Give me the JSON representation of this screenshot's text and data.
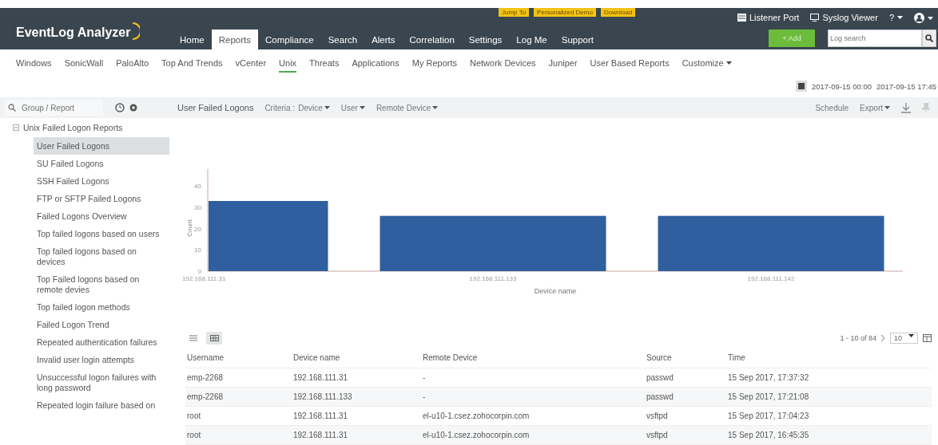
{
  "header": {
    "logo": "EventLog Analyzer",
    "promo_links": [
      "Jump To",
      "Personalized Demo",
      "Download"
    ],
    "tools": [
      {
        "kind": "listener",
        "label": "Listener Port"
      },
      {
        "kind": "syslog",
        "label": "Syslog Viewer"
      },
      {
        "kind": "help",
        "label": "?"
      },
      {
        "kind": "user"
      }
    ],
    "nav": [
      {
        "label": "Home",
        "selected": false
      },
      {
        "label": "Reports",
        "selected": true
      },
      {
        "label": "Compliance",
        "selected": false
      },
      {
        "label": "Search",
        "selected": false
      },
      {
        "label": "Alerts",
        "selected": false
      },
      {
        "label": "Correlation",
        "selected": false
      },
      {
        "label": "Settings",
        "selected": false
      },
      {
        "label": "Log Me",
        "selected": false
      },
      {
        "label": "Support",
        "selected": false
      }
    ],
    "add_button": "+ Add",
    "search": {
      "placeholder": "Log search"
    }
  },
  "subnav": {
    "items": [
      {
        "label": "Windows",
        "selected": false
      },
      {
        "label": "SonicWall",
        "selected": false
      },
      {
        "label": "PaloAlto",
        "selected": false
      },
      {
        "label": "Top And Trends",
        "selected": false
      },
      {
        "label": "vCenter",
        "selected": false
      },
      {
        "label": "Unix",
        "selected": true
      },
      {
        "label": "Threats",
        "selected": false
      },
      {
        "label": "Applications",
        "selected": false
      },
      {
        "label": "My Reports",
        "selected": false
      },
      {
        "label": "Network Devices",
        "selected": false
      },
      {
        "label": "Juniper",
        "selected": false
      },
      {
        "label": "User Based Reports",
        "selected": false
      }
    ],
    "customize": "Customize"
  },
  "date_range": {
    "from": "2017-09-15 00:00",
    "to": "2017-09-15 17:45"
  },
  "sidebar": {
    "search": {
      "placeholder": "Group / Report"
    },
    "group": {
      "label": "Unix Failed Logon Reports",
      "expanded": true,
      "children": [
        {
          "label": "User Failed Logons",
          "selected": true
        },
        {
          "label": "SU Failed Logons",
          "selected": false
        },
        {
          "label": "SSH Failed Logons",
          "selected": false
        },
        {
          "label": "FTP or SFTP Failed Logons",
          "selected": false
        },
        {
          "label": "Failed Logons Overview",
          "selected": false
        },
        {
          "label": "Top failed logons based on users",
          "selected": false
        },
        {
          "label": "Top failed logons based on devices",
          "selected": false
        },
        {
          "label": "Top Failed logons based on remote devies",
          "selected": false
        },
        {
          "label": "Top failed logon methods",
          "selected": false
        },
        {
          "label": "Failed Logon Trend",
          "selected": false
        },
        {
          "label": "Repeated authentication failures",
          "selected": false
        },
        {
          "label": "Invalid user login attempts",
          "selected": false
        },
        {
          "label": "Unsuccessful logon failures with long password",
          "selected": false
        },
        {
          "label": "Repeated login failure based on",
          "selected": false
        }
      ]
    }
  },
  "toolbar": {
    "title": "User Failed Logons",
    "criteria_label": "Criteria :",
    "filters": [
      "Device",
      "User",
      "Remote Device"
    ],
    "schedule": "Schedule",
    "export": "Export"
  },
  "chart_data": {
    "type": "bar",
    "xlabel": "Device name",
    "ylabel": "Count",
    "categories": [
      "192.168.111.31",
      "192.168.111.133",
      "192.168.111.142"
    ],
    "values": [
      33,
      26,
      26
    ],
    "ylim": [
      0,
      48
    ],
    "yticks": [
      0,
      10,
      20,
      30,
      40
    ]
  },
  "table": {
    "views": [
      {
        "kind": "list",
        "selected": false
      },
      {
        "kind": "grid",
        "selected": true
      }
    ],
    "pagination": "1 - 10 of 84",
    "page_size": "10",
    "columns": [
      "Username",
      "Device name",
      "Remote Device",
      "Source",
      "Time"
    ],
    "rows": [
      [
        "emp-2268",
        "192.168.111.31",
        "-",
        "passwd",
        "15 Sep 2017, 17:37:32"
      ],
      [
        "emp-2268",
        "192.168.111.133",
        "-",
        "passwd",
        "15 Sep 2017, 17:21:08"
      ],
      [
        "root",
        "192.168.111.31",
        "el-u10-1.csez.zohocorpin.com",
        "vsftpd",
        "15 Sep 2017, 17:04:23"
      ],
      [
        "root",
        "192.168.111.31",
        "el-u10-1.csez.zohocorpin.com",
        "vsftpd",
        "15 Sep 2017, 16:45:35"
      ]
    ]
  }
}
